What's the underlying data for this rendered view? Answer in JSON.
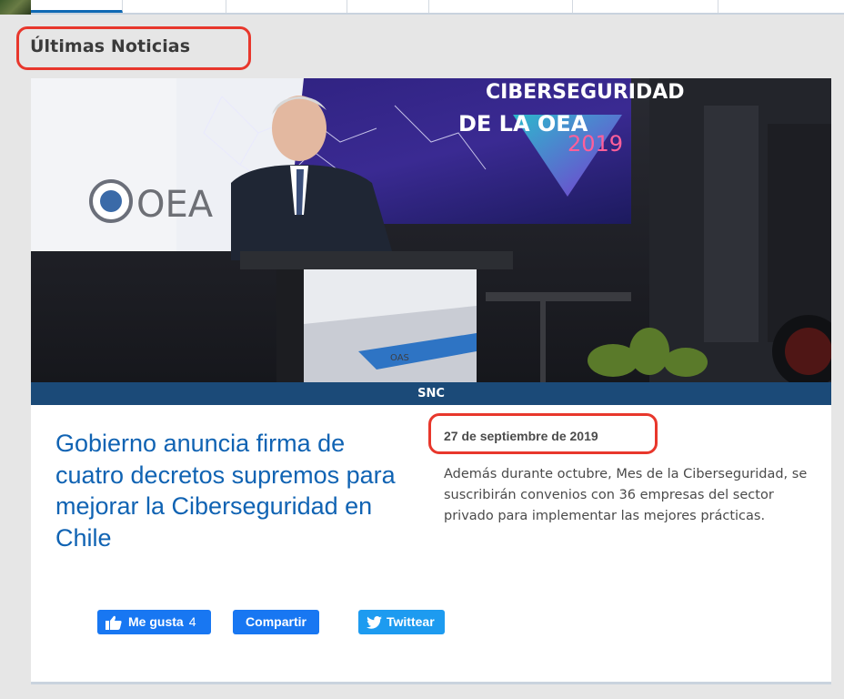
{
  "section": {
    "title": "Últimas Noticias"
  },
  "article": {
    "image_alt": "Hombre hablando en un podio frente a una pantalla de la OEA sobre Ciberseguridad 2019",
    "screen_text": {
      "line1": "CIBERSEGURIDAD",
      "line2": "DE LA OEA",
      "year": "2019",
      "logo": "OEA",
      "podium_logo": "OAS"
    },
    "source": "SNC",
    "headline": "Gobierno anuncia firma de cuatro decretos supremos para mejorar la Ciberseguridad en Chile",
    "date": "27 de septiembre de 2019",
    "summary": "Además durante octubre, Mes de la Ciberseguridad, se suscribirán convenios con 36 empresas del sector privado para implementar las mejores prácticas."
  },
  "social": {
    "like_label": "Me gusta",
    "like_count": "4",
    "share_label": "Compartir",
    "tweet_label": "Twittear"
  },
  "colors": {
    "link_blue": "#1063b3",
    "source_bar": "#1b4a78",
    "facebook": "#1877f2",
    "twitter": "#1d9bf0",
    "annotation": "#e8372c"
  }
}
